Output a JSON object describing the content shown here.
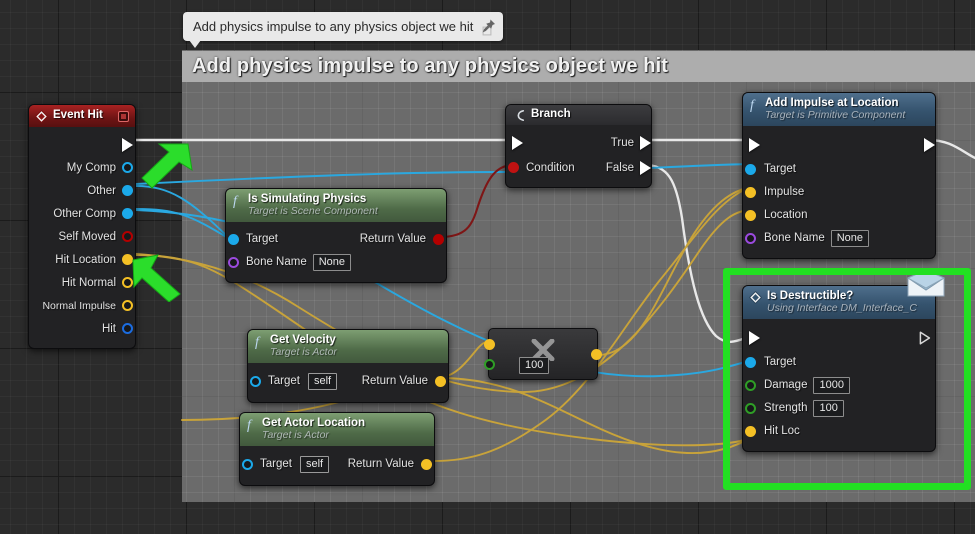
{
  "app": {
    "title": "Unreal Engine Blueprint Graph Editor",
    "canvas_bg": "#2b2b2b",
    "comment_bg": "#6b6b6b",
    "highlight_color": "#22e022",
    "arrow_color": "#2bdd2b"
  },
  "tooltip": {
    "text": "Add physics impulse to any physics object we hit",
    "pin_icon": "pushpin-icon"
  },
  "comment": {
    "title": "Add physics impulse to any physics object we hit"
  },
  "nodes": {
    "event_hit": {
      "title": "Event Hit",
      "icon": "event-diamond-icon",
      "close_icon": "close-square-icon",
      "pins": [
        {
          "label": "",
          "type": "exec"
        },
        {
          "label": "My Comp",
          "type": "object"
        },
        {
          "label": "Other",
          "type": "object"
        },
        {
          "label": "Other Comp",
          "type": "object"
        },
        {
          "label": "Self Moved",
          "type": "bool"
        },
        {
          "label": "Hit Location",
          "type": "vector"
        },
        {
          "label": "Hit Normal",
          "type": "vector"
        },
        {
          "label": "Normal Impulse",
          "type": "vector"
        },
        {
          "label": "Hit",
          "type": "struct"
        }
      ]
    },
    "is_simulating_physics": {
      "title": "Is Simulating Physics",
      "subtitle": "Target is Scene Component",
      "icon": "function-f-icon",
      "inputs": [
        {
          "label": "Target",
          "type": "object"
        },
        {
          "label": "Bone Name",
          "type": "name",
          "value": "None"
        }
      ],
      "outputs": [
        {
          "label": "Return Value",
          "type": "bool"
        }
      ]
    },
    "branch": {
      "title": "Branch",
      "icon": "branch-icon",
      "inputs": [
        {
          "label": "",
          "type": "exec"
        },
        {
          "label": "Condition",
          "type": "bool"
        }
      ],
      "outputs": [
        {
          "label": "True",
          "type": "exec"
        },
        {
          "label": "False",
          "type": "exec"
        }
      ]
    },
    "add_impulse_at_location": {
      "title": "Add Impulse at Location",
      "subtitle": "Target is Primitive Component",
      "icon": "function-f-icon",
      "inputs": [
        {
          "label": "",
          "type": "exec"
        },
        {
          "label": "Target",
          "type": "object"
        },
        {
          "label": "Impulse",
          "type": "vector"
        },
        {
          "label": "Location",
          "type": "vector"
        },
        {
          "label": "Bone Name",
          "type": "name",
          "value": "None"
        }
      ],
      "outputs": [
        {
          "label": "",
          "type": "exec"
        }
      ]
    },
    "get_velocity": {
      "title": "Get Velocity",
      "subtitle": "Target is Actor",
      "icon": "function-f-icon",
      "inputs": [
        {
          "label": "Target",
          "type": "object",
          "value": "self"
        }
      ],
      "outputs": [
        {
          "label": "Return Value",
          "type": "vector"
        }
      ]
    },
    "get_actor_location": {
      "title": "Get Actor Location",
      "subtitle": "Target is Actor",
      "icon": "function-f-icon",
      "inputs": [
        {
          "label": "Target",
          "type": "object",
          "value": "self"
        }
      ],
      "outputs": [
        {
          "label": "Return Value",
          "type": "vector"
        }
      ]
    },
    "multiply": {
      "title": "",
      "icon": "multiply-x-icon",
      "inputs": [
        {
          "label": "",
          "type": "vector"
        },
        {
          "label": "",
          "type": "float",
          "value": "100"
        }
      ],
      "outputs": [
        {
          "label": "",
          "type": "vector"
        }
      ]
    },
    "is_destructible": {
      "title": "Is Destructible?",
      "subtitle": "Using Interface DM_Interface_C",
      "icon": "event-diamond-icon",
      "badge_icon": "envelope-icon",
      "inputs": [
        {
          "label": "",
          "type": "exec"
        },
        {
          "label": "Target",
          "type": "object"
        },
        {
          "label": "Damage",
          "type": "float",
          "value": "1000"
        },
        {
          "label": "Strength",
          "type": "float",
          "value": "100"
        },
        {
          "label": "Hit Loc",
          "type": "vector"
        }
      ],
      "outputs": [
        {
          "label": "",
          "type": "exec-hollow"
        }
      ]
    }
  },
  "annotations": [
    {
      "name": "arrow-to-other-pin",
      "target": "Other"
    },
    {
      "name": "arrow-to-hit-location-pin",
      "target": "Hit Location"
    }
  ],
  "pin_colors": {
    "exec": "#ffffff",
    "object": "#1ba9ea",
    "bool": "#b40000",
    "vector": "#f4c025",
    "name": "#9b4ade",
    "float": "#2f9e26",
    "struct": "#1b6ce0"
  }
}
